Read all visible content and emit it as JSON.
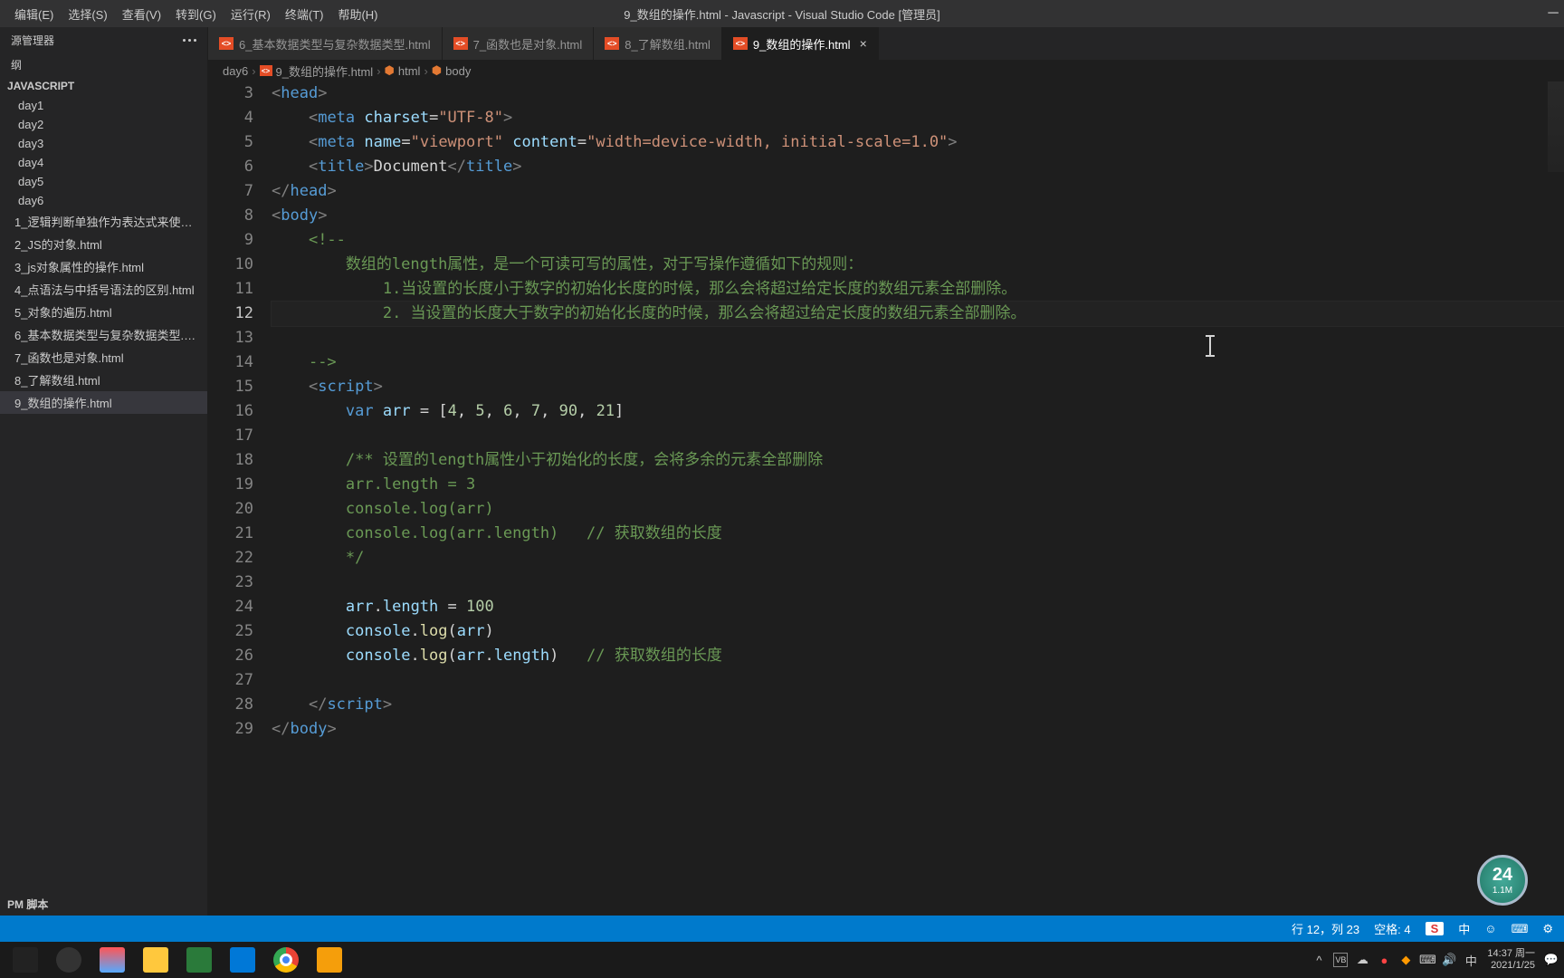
{
  "menu": [
    "编辑(E)",
    "选择(S)",
    "查看(V)",
    "转到(G)",
    "运行(R)",
    "终端(T)",
    "帮助(H)"
  ],
  "window_title": "9_数组的操作.html - Javascript - Visual Studio Code [管理员]",
  "sidebar": {
    "header": "源管理器",
    "outline": "纲",
    "section": "JAVASCRIPT",
    "folders": [
      "day1",
      "day2",
      "day3",
      "day4",
      "day5",
      "day6"
    ],
    "files": [
      "1_逻辑判断单独作为表达式来使用....",
      "2_JS的对象.html",
      "3_js对象属性的操作.html",
      "4_点语法与中括号语法的区别.html",
      "5_对象的遍历.html",
      "6_基本数据类型与复杂数据类型.html",
      "7_函数也是对象.html",
      "8_了解数组.html",
      "9_数组的操作.html"
    ],
    "bottom": "PM 脚本"
  },
  "tabs": [
    {
      "label": "6_基本数据类型与复杂数据类型.html"
    },
    {
      "label": "7_函数也是对象.html"
    },
    {
      "label": "8_了解数组.html"
    },
    {
      "label": "9_数组的操作.html",
      "active": true
    }
  ],
  "breadcrumb": [
    "day6",
    "9_数组的操作.html",
    "html",
    "body"
  ],
  "code_lines": [
    3,
    4,
    5,
    6,
    7,
    8,
    9,
    10,
    11,
    12,
    13,
    14,
    15,
    16,
    17,
    18,
    19,
    20,
    21,
    22,
    23,
    24,
    25,
    26,
    27,
    28,
    29
  ],
  "active_line": 12,
  "comments": {
    "l10": "数组的length属性，是一个可读可写的属性，对于写操作遵循如下的规则：",
    "l11": "1.当设置的长度小于数字的初始化长度的时候，那么会将超过给定长度的数组元素全部删除。",
    "l12": "2. 当设置的长度大于数字的初始化长度的时候，那么会将超过给定长度的数组元素全部删除。",
    "l18": "/** 设置的length属性小于初始化的长度，会将多余的元素全部删除",
    "l21": "// 获取数组的长度",
    "l26": "// 获取数组的长度"
  },
  "code": {
    "arr_decl": "var arr = [4, 5, 6, 7, 90, 21]",
    "len3": "arr.length = 3",
    "log1": "console.log(arr)",
    "log2": "console.log(arr.length)",
    "endc": "*/",
    "len100": "arr.length = 100"
  },
  "statusbar": {
    "pos": "行 12，列 23",
    "spaces": "空格: 4"
  },
  "clock": {
    "time": "14:37 周一",
    "date": "2021/1/25"
  },
  "badge": {
    "num": "24",
    "sub": "1.1M"
  },
  "ime": "中"
}
